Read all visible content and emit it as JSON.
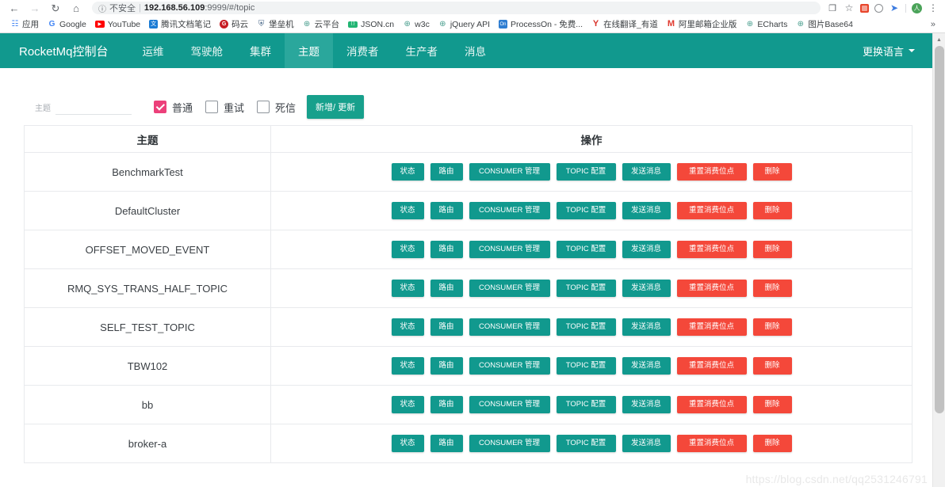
{
  "browser": {
    "nav": {
      "back_icon": "back-arrow-icon",
      "forward_icon": "forward-arrow-icon",
      "reload_icon": "reload-icon",
      "home_icon": "home-icon",
      "back_glyph": "←",
      "forward_glyph": "→",
      "reload_glyph": "↻",
      "home_glyph": "⌂"
    },
    "omnibox": {
      "info_glyph": "ⓘ",
      "security_label": "不安全",
      "separator": "|",
      "url_host": "192.168.56.109",
      "url_rest": ":9999/#/topic"
    },
    "toolbar_icons": [
      {
        "name": "translate-icon",
        "glyph": "❐"
      },
      {
        "name": "bookmark-star-icon",
        "glyph": "☆"
      },
      {
        "name": "extension-red-icon",
        "glyph": ""
      },
      {
        "name": "extension-circle-icon",
        "glyph": ""
      },
      {
        "name": "extension-blue-icon",
        "glyph": "➤"
      }
    ],
    "avatar_label": "人",
    "menu_glyph": "⋮",
    "bookmarks": [
      {
        "label": "应用",
        "icon": "apps-grid-icon",
        "glyph": "░"
      },
      {
        "label": "Google",
        "icon": "google-icon",
        "glyph": "G"
      },
      {
        "label": "YouTube",
        "icon": "youtube-icon",
        "glyph": "▶"
      },
      {
        "label": "腾讯文档笔记",
        "icon": "tencent-docs-icon",
        "glyph": "文"
      },
      {
        "label": "码云",
        "icon": "gitee-icon",
        "glyph": "G"
      },
      {
        "label": "堡垒机",
        "icon": "shield-icon",
        "glyph": "⛨"
      },
      {
        "label": "云平台",
        "icon": "globe-icon",
        "glyph": "⊕"
      },
      {
        "label": "JSON.cn",
        "icon": "json-icon",
        "glyph": "{ }"
      },
      {
        "label": "w3c",
        "icon": "globe-icon",
        "glyph": "⊕"
      },
      {
        "label": "jQuery API",
        "icon": "globe-icon",
        "glyph": "⊕"
      },
      {
        "label": "ProcessOn - 免费...",
        "icon": "processon-icon",
        "glyph": "On"
      },
      {
        "label": "在线翻译_有道",
        "icon": "youdao-icon",
        "glyph": "Y"
      },
      {
        "label": "阿里邮箱企业版",
        "icon": "alimail-icon",
        "glyph": "M"
      },
      {
        "label": "ECharts",
        "icon": "globe-icon",
        "glyph": "⊕"
      },
      {
        "label": "图片Base64",
        "icon": "globe-icon",
        "glyph": "⊕"
      }
    ],
    "bookmarks_overflow_glyph": "»"
  },
  "app": {
    "brand": "RocketMq控制台",
    "nav_items": [
      {
        "label": "运维",
        "active": false
      },
      {
        "label": "驾驶舱",
        "active": false
      },
      {
        "label": "集群",
        "active": false
      },
      {
        "label": "主题",
        "active": true
      },
      {
        "label": "消费者",
        "active": false
      },
      {
        "label": "生产者",
        "active": false
      },
      {
        "label": "消息",
        "active": false
      }
    ],
    "language_switch": "更换语言",
    "accent_color": "#11998e",
    "accent_active_color": "#2aa79c",
    "danger_color": "#f4483a",
    "checkbox_color": "#ec407a"
  },
  "filter": {
    "topic_label": "主题",
    "topic_value": "",
    "topic_placeholder": "",
    "checkboxes": [
      {
        "label": "普通",
        "checked": true
      },
      {
        "label": "重试",
        "checked": false
      },
      {
        "label": "死信",
        "checked": false
      }
    ],
    "add_update_button": "新增/ 更新"
  },
  "table": {
    "headers": {
      "name": "主题",
      "operations": "操作"
    },
    "actions": [
      {
        "label": "状态",
        "style": "primary",
        "size": "w-status"
      },
      {
        "label": "路由",
        "style": "primary",
        "size": "w-route"
      },
      {
        "label": "CONSUMER 管理",
        "style": "primary",
        "size": "w-consumer"
      },
      {
        "label": "TOPIC 配置",
        "style": "primary",
        "size": "w-topiccfg"
      },
      {
        "label": "发送消息",
        "style": "primary",
        "size": "w-send"
      },
      {
        "label": "重置消费位点",
        "style": "danger",
        "size": "w-reset"
      },
      {
        "label": "删除",
        "style": "danger",
        "size": "w-del"
      }
    ],
    "rows": [
      {
        "name": "BenchmarkTest"
      },
      {
        "name": "DefaultCluster"
      },
      {
        "name": "OFFSET_MOVED_EVENT"
      },
      {
        "name": "RMQ_SYS_TRANS_HALF_TOPIC"
      },
      {
        "name": "SELF_TEST_TOPIC"
      },
      {
        "name": "TBW102"
      },
      {
        "name": "bb"
      },
      {
        "name": "broker-a"
      }
    ]
  },
  "scrollbar": {
    "up_arrow_glyph": "▲",
    "position_percent": 0
  },
  "watermark": "https://blog.csdn.net/qq2531246791"
}
